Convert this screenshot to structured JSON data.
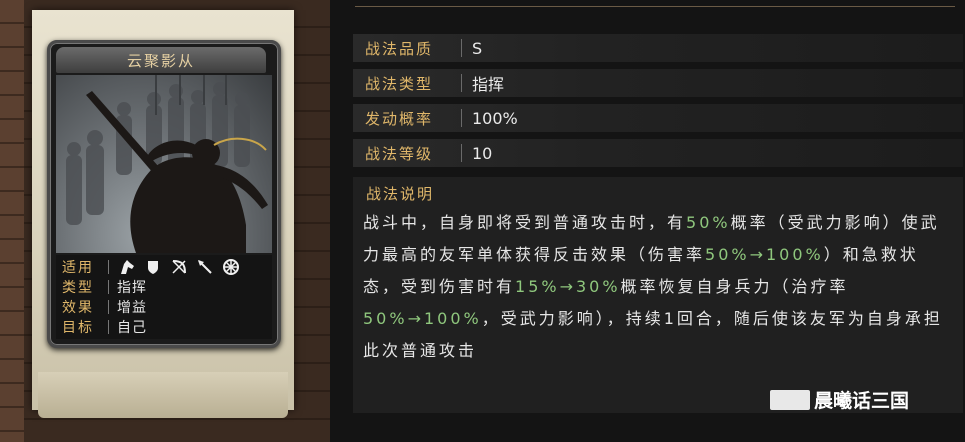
{
  "card": {
    "title": "云聚影从",
    "meta": [
      {
        "label": "适用",
        "value": ""
      },
      {
        "label": "类型",
        "value": "指挥"
      },
      {
        "label": "效果",
        "value": "增益"
      },
      {
        "label": "目标",
        "value": "自己"
      }
    ],
    "unit_icons": [
      "cavalry-icon",
      "shield-icon",
      "bow-icon",
      "spear-icon",
      "wheel-icon"
    ]
  },
  "info": [
    {
      "label": "战法品质",
      "value": "S"
    },
    {
      "label": "战法类型",
      "value": "指挥"
    },
    {
      "label": "发动概率",
      "value": "100%"
    },
    {
      "label": "战法等级",
      "value": "10"
    }
  ],
  "description": {
    "title": "战法说明",
    "parts": [
      {
        "text": "战斗中，自身即将受到普通攻击时，有",
        "hl": false
      },
      {
        "text": "50%",
        "hl": true
      },
      {
        "text": "概率（受武力影响）使武力最高的友军单体获得反击效果（伤害率",
        "hl": false
      },
      {
        "text": "50%→100%",
        "hl": true
      },
      {
        "text": "）和急救状态，受到伤害时有",
        "hl": false
      },
      {
        "text": "15%→30%",
        "hl": true
      },
      {
        "text": "概率恢复自身兵力（治疗率",
        "hl": false
      },
      {
        "text": "50%→100%",
        "hl": true
      },
      {
        "text": "，受武力影响），持续1回合，随后使该友军为自身承担此次普通攻击",
        "hl": false
      }
    ]
  },
  "watermark": "晨曦话三国",
  "colors": {
    "label_gold": "#e0b76a",
    "highlight_green": "#8fc77d"
  }
}
